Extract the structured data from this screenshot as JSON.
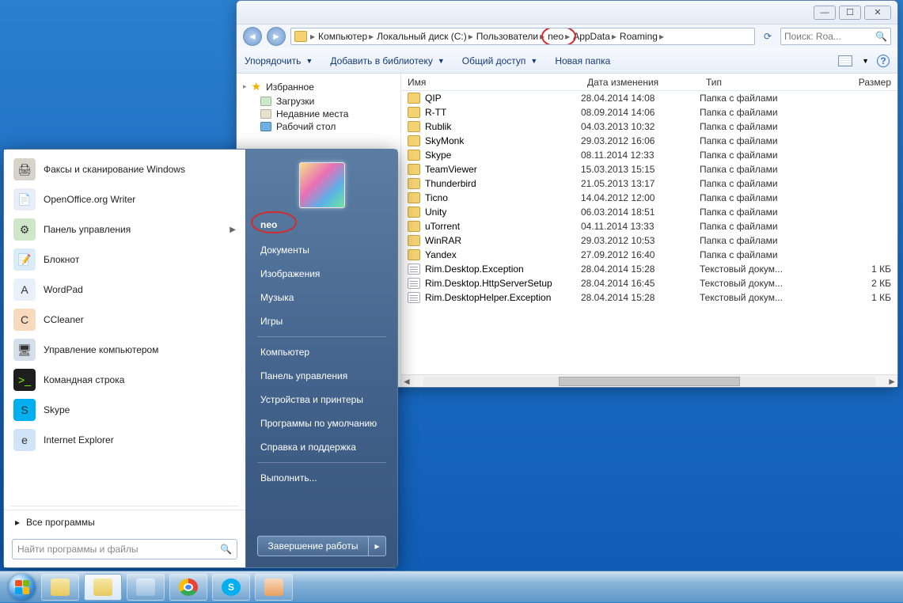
{
  "explorer": {
    "breadcrumb": [
      "Компьютер",
      "Локальный диск (C:)",
      "Пользователи",
      "neo",
      "AppData",
      "Roaming"
    ],
    "highlight_index": 3,
    "search_placeholder": "Поиск: Roa...",
    "toolbar": {
      "organize": "Упорядочить",
      "add_library": "Добавить в библиотеку",
      "share": "Общий доступ",
      "new_folder": "Новая папка"
    },
    "nav": {
      "favorites": "Избранное",
      "downloads": "Загрузки",
      "recent": "Недавние места",
      "desktop": "Рабочий стол"
    },
    "columns": {
      "name": "Имя",
      "date": "Дата изменения",
      "type": "Тип",
      "size": "Размер"
    },
    "files": [
      {
        "name": "QIP",
        "date": "28.04.2014 14:08",
        "type": "Папка с файлами",
        "size": "",
        "icon": "folder"
      },
      {
        "name": "R-TT",
        "date": "08.09.2014 14:06",
        "type": "Папка с файлами",
        "size": "",
        "icon": "folder"
      },
      {
        "name": "Rublik",
        "date": "04.03.2013 10:32",
        "type": "Папка с файлами",
        "size": "",
        "icon": "folder"
      },
      {
        "name": "SkyMonk",
        "date": "29.03.2012 16:06",
        "type": "Папка с файлами",
        "size": "",
        "icon": "folder"
      },
      {
        "name": "Skype",
        "date": "08.11.2014 12:33",
        "type": "Папка с файлами",
        "size": "",
        "icon": "folder"
      },
      {
        "name": "TeamViewer",
        "date": "15.03.2013 15:15",
        "type": "Папка с файлами",
        "size": "",
        "icon": "folder"
      },
      {
        "name": "Thunderbird",
        "date": "21.05.2013 13:17",
        "type": "Папка с файлами",
        "size": "",
        "icon": "folder"
      },
      {
        "name": "Ticno",
        "date": "14.04.2012 12:00",
        "type": "Папка с файлами",
        "size": "",
        "icon": "folder"
      },
      {
        "name": "Unity",
        "date": "06.03.2014 18:51",
        "type": "Папка с файлами",
        "size": "",
        "icon": "folder"
      },
      {
        "name": "uTorrent",
        "date": "04.11.2014 13:33",
        "type": "Папка с файлами",
        "size": "",
        "icon": "folder"
      },
      {
        "name": "WinRAR",
        "date": "29.03.2012 10:53",
        "type": "Папка с файлами",
        "size": "",
        "icon": "folder"
      },
      {
        "name": "Yandex",
        "date": "27.09.2012 16:40",
        "type": "Папка с файлами",
        "size": "",
        "icon": "folder"
      },
      {
        "name": "Rim.Desktop.Exception",
        "date": "28.04.2014 15:28",
        "type": "Текстовый докум...",
        "size": "1 КБ",
        "icon": "txt"
      },
      {
        "name": "Rim.Desktop.HttpServerSetup",
        "date": "28.04.2014 16:45",
        "type": "Текстовый докум...",
        "size": "2 КБ",
        "icon": "txt"
      },
      {
        "name": "Rim.DesktopHelper.Exception",
        "date": "28.04.2014 15:28",
        "type": "Текстовый докум...",
        "size": "1 КБ",
        "icon": "txt"
      }
    ]
  },
  "start": {
    "programs": [
      {
        "label": "Факсы и сканирование Windows",
        "icon_bg": "#d7d3cb",
        "icon_txt": "🖨"
      },
      {
        "label": "OpenOffice.org Writer",
        "icon_bg": "#e8eef7",
        "icon_txt": "📄"
      },
      {
        "label": "Панель управления",
        "icon_bg": "#cfe7c8",
        "icon_txt": "⚙",
        "has_sub": true
      },
      {
        "label": "Блокнот",
        "icon_bg": "#d9ecf7",
        "icon_txt": "📝"
      },
      {
        "label": "WordPad",
        "icon_bg": "#e8f0fb",
        "icon_txt": "A"
      },
      {
        "label": "CCleaner",
        "icon_bg": "#f7d9bc",
        "icon_txt": "C"
      },
      {
        "label": "Управление компьютером",
        "icon_bg": "#d5dfe9",
        "icon_txt": "🖥"
      },
      {
        "label": "Командная строка",
        "icon_bg": "#1e1e1e",
        "icon_txt": ">_"
      },
      {
        "label": "Skype",
        "icon_bg": "#00aff0",
        "icon_txt": "S"
      },
      {
        "label": "Internet Explorer",
        "icon_bg": "#cfe5f7",
        "icon_txt": "e"
      }
    ],
    "all_programs": "Все программы",
    "search_placeholder": "Найти программы и файлы",
    "user": "neo",
    "right_items": [
      "Документы",
      "Изображения",
      "Музыка",
      "Игры",
      "Компьютер",
      "Панель управления",
      "Устройства и принтеры",
      "Программы по умолчанию",
      "Справка и поддержка",
      "Выполнить..."
    ],
    "right_sep_after": [
      4,
      9
    ],
    "shutdown": "Завершение работы"
  },
  "taskbar": {
    "items": [
      "start",
      "explorer-pin",
      "explorer-active",
      "ie",
      "chrome",
      "skype",
      "paint"
    ]
  }
}
